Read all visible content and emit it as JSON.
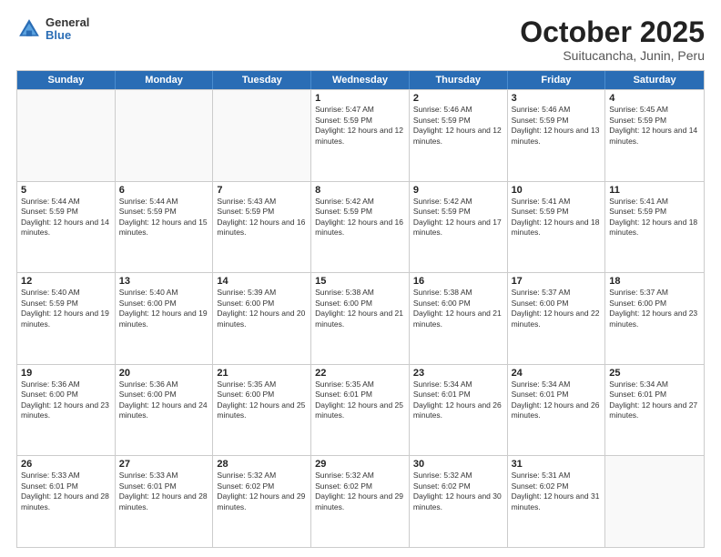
{
  "header": {
    "logo": {
      "general": "General",
      "blue": "Blue"
    },
    "title": "October 2025",
    "subtitle": "Suitucancha, Junin, Peru"
  },
  "calendar": {
    "days_of_week": [
      "Sunday",
      "Monday",
      "Tuesday",
      "Wednesday",
      "Thursday",
      "Friday",
      "Saturday"
    ],
    "weeks": [
      [
        {
          "day": "",
          "sunrise": "",
          "sunset": "",
          "daylight": ""
        },
        {
          "day": "",
          "sunrise": "",
          "sunset": "",
          "daylight": ""
        },
        {
          "day": "",
          "sunrise": "",
          "sunset": "",
          "daylight": ""
        },
        {
          "day": "1",
          "sunrise": "Sunrise: 5:47 AM",
          "sunset": "Sunset: 5:59 PM",
          "daylight": "Daylight: 12 hours and 12 minutes."
        },
        {
          "day": "2",
          "sunrise": "Sunrise: 5:46 AM",
          "sunset": "Sunset: 5:59 PM",
          "daylight": "Daylight: 12 hours and 12 minutes."
        },
        {
          "day": "3",
          "sunrise": "Sunrise: 5:46 AM",
          "sunset": "Sunset: 5:59 PM",
          "daylight": "Daylight: 12 hours and 13 minutes."
        },
        {
          "day": "4",
          "sunrise": "Sunrise: 5:45 AM",
          "sunset": "Sunset: 5:59 PM",
          "daylight": "Daylight: 12 hours and 14 minutes."
        }
      ],
      [
        {
          "day": "5",
          "sunrise": "Sunrise: 5:44 AM",
          "sunset": "Sunset: 5:59 PM",
          "daylight": "Daylight: 12 hours and 14 minutes."
        },
        {
          "day": "6",
          "sunrise": "Sunrise: 5:44 AM",
          "sunset": "Sunset: 5:59 PM",
          "daylight": "Daylight: 12 hours and 15 minutes."
        },
        {
          "day": "7",
          "sunrise": "Sunrise: 5:43 AM",
          "sunset": "Sunset: 5:59 PM",
          "daylight": "Daylight: 12 hours and 16 minutes."
        },
        {
          "day": "8",
          "sunrise": "Sunrise: 5:42 AM",
          "sunset": "Sunset: 5:59 PM",
          "daylight": "Daylight: 12 hours and 16 minutes."
        },
        {
          "day": "9",
          "sunrise": "Sunrise: 5:42 AM",
          "sunset": "Sunset: 5:59 PM",
          "daylight": "Daylight: 12 hours and 17 minutes."
        },
        {
          "day": "10",
          "sunrise": "Sunrise: 5:41 AM",
          "sunset": "Sunset: 5:59 PM",
          "daylight": "Daylight: 12 hours and 18 minutes."
        },
        {
          "day": "11",
          "sunrise": "Sunrise: 5:41 AM",
          "sunset": "Sunset: 5:59 PM",
          "daylight": "Daylight: 12 hours and 18 minutes."
        }
      ],
      [
        {
          "day": "12",
          "sunrise": "Sunrise: 5:40 AM",
          "sunset": "Sunset: 5:59 PM",
          "daylight": "Daylight: 12 hours and 19 minutes."
        },
        {
          "day": "13",
          "sunrise": "Sunrise: 5:40 AM",
          "sunset": "Sunset: 6:00 PM",
          "daylight": "Daylight: 12 hours and 19 minutes."
        },
        {
          "day": "14",
          "sunrise": "Sunrise: 5:39 AM",
          "sunset": "Sunset: 6:00 PM",
          "daylight": "Daylight: 12 hours and 20 minutes."
        },
        {
          "day": "15",
          "sunrise": "Sunrise: 5:38 AM",
          "sunset": "Sunset: 6:00 PM",
          "daylight": "Daylight: 12 hours and 21 minutes."
        },
        {
          "day": "16",
          "sunrise": "Sunrise: 5:38 AM",
          "sunset": "Sunset: 6:00 PM",
          "daylight": "Daylight: 12 hours and 21 minutes."
        },
        {
          "day": "17",
          "sunrise": "Sunrise: 5:37 AM",
          "sunset": "Sunset: 6:00 PM",
          "daylight": "Daylight: 12 hours and 22 minutes."
        },
        {
          "day": "18",
          "sunrise": "Sunrise: 5:37 AM",
          "sunset": "Sunset: 6:00 PM",
          "daylight": "Daylight: 12 hours and 23 minutes."
        }
      ],
      [
        {
          "day": "19",
          "sunrise": "Sunrise: 5:36 AM",
          "sunset": "Sunset: 6:00 PM",
          "daylight": "Daylight: 12 hours and 23 minutes."
        },
        {
          "day": "20",
          "sunrise": "Sunrise: 5:36 AM",
          "sunset": "Sunset: 6:00 PM",
          "daylight": "Daylight: 12 hours and 24 minutes."
        },
        {
          "day": "21",
          "sunrise": "Sunrise: 5:35 AM",
          "sunset": "Sunset: 6:00 PM",
          "daylight": "Daylight: 12 hours and 25 minutes."
        },
        {
          "day": "22",
          "sunrise": "Sunrise: 5:35 AM",
          "sunset": "Sunset: 6:01 PM",
          "daylight": "Daylight: 12 hours and 25 minutes."
        },
        {
          "day": "23",
          "sunrise": "Sunrise: 5:34 AM",
          "sunset": "Sunset: 6:01 PM",
          "daylight": "Daylight: 12 hours and 26 minutes."
        },
        {
          "day": "24",
          "sunrise": "Sunrise: 5:34 AM",
          "sunset": "Sunset: 6:01 PM",
          "daylight": "Daylight: 12 hours and 26 minutes."
        },
        {
          "day": "25",
          "sunrise": "Sunrise: 5:34 AM",
          "sunset": "Sunset: 6:01 PM",
          "daylight": "Daylight: 12 hours and 27 minutes."
        }
      ],
      [
        {
          "day": "26",
          "sunrise": "Sunrise: 5:33 AM",
          "sunset": "Sunset: 6:01 PM",
          "daylight": "Daylight: 12 hours and 28 minutes."
        },
        {
          "day": "27",
          "sunrise": "Sunrise: 5:33 AM",
          "sunset": "Sunset: 6:01 PM",
          "daylight": "Daylight: 12 hours and 28 minutes."
        },
        {
          "day": "28",
          "sunrise": "Sunrise: 5:32 AM",
          "sunset": "Sunset: 6:02 PM",
          "daylight": "Daylight: 12 hours and 29 minutes."
        },
        {
          "day": "29",
          "sunrise": "Sunrise: 5:32 AM",
          "sunset": "Sunset: 6:02 PM",
          "daylight": "Daylight: 12 hours and 29 minutes."
        },
        {
          "day": "30",
          "sunrise": "Sunrise: 5:32 AM",
          "sunset": "Sunset: 6:02 PM",
          "daylight": "Daylight: 12 hours and 30 minutes."
        },
        {
          "day": "31",
          "sunrise": "Sunrise: 5:31 AM",
          "sunset": "Sunset: 6:02 PM",
          "daylight": "Daylight: 12 hours and 31 minutes."
        },
        {
          "day": "",
          "sunrise": "",
          "sunset": "",
          "daylight": ""
        }
      ]
    ]
  }
}
